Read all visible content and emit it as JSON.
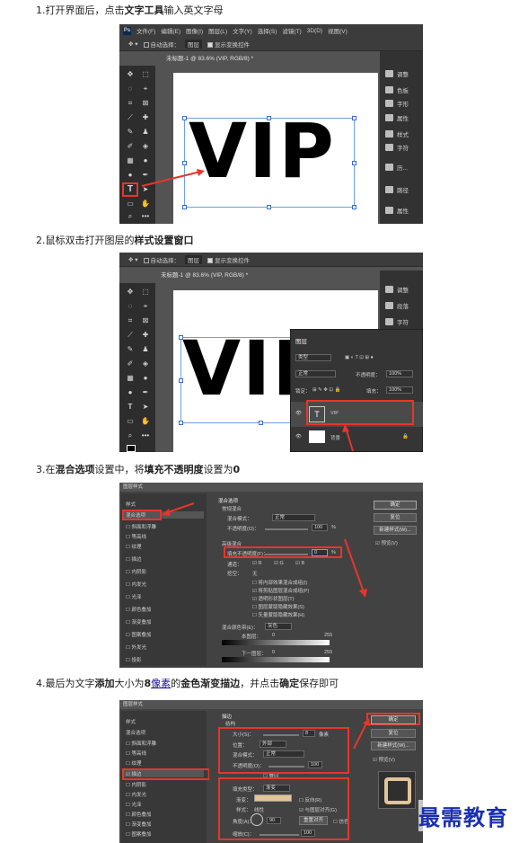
{
  "steps": {
    "s1": {
      "pre": "1.打开界面后，点击",
      "bold": "文字工具",
      "post": "输入英文字母"
    },
    "s2": {
      "pre": "2.鼠标双击打开图层的",
      "bold": "样式设置窗口",
      "post": ""
    },
    "s3": {
      "pre": "3.在",
      "bold1": "混合选项",
      "mid": "设置中，将",
      "bold2": "填充不透明度",
      "mid2": "设置为",
      "bold3": "0"
    },
    "s4": {
      "pre": "4.最后为文字",
      "b1": "添加",
      "t1": "大小为",
      "b2": "8",
      "link": "像素",
      "t2": "的",
      "b3": "金色渐变描边",
      "t3": "，并点击",
      "b4": "确定",
      "t4": "保存即可"
    }
  },
  "ps": {
    "logo": "Ps",
    "menu": [
      "文件(F)",
      "编辑(E)",
      "图像(I)",
      "图层(L)",
      "文字(Y)",
      "选择(S)",
      "滤镜(T)",
      "3D(D)",
      "视图(V)"
    ],
    "opts_auto_select": "自动选择：",
    "opts_layer": "图层",
    "opts_show_transform": "显示变换控件",
    "doc_tab": "未标题-1 @ 83.6% (VIP, RGB/8) *",
    "canvas_text": "VIP",
    "right_panel_1": [
      "调整",
      "色板",
      "字形",
      "属性",
      "样式",
      "字符",
      "历...",
      "路径",
      "属性"
    ],
    "right_panel_2": [
      "调整",
      "段落",
      "字符"
    ]
  },
  "layers_panel": {
    "title": "图层",
    "kind": "类型",
    "blend": "正常",
    "opacity_label": "不透明度：",
    "opacity": "100%",
    "lock_label": "锁定：",
    "fill_label": "填充：",
    "fill": "100%",
    "layer_vip": "VIP",
    "layer_bg": "背景"
  },
  "dialog3": {
    "title": "图层样式",
    "left_items": [
      "样式",
      "混合选项",
      "斜面和浮雕",
      "等高线",
      "纹理",
      "描边",
      "内阴影",
      "内发光",
      "光泽",
      "颜色叠加",
      "渐变叠加",
      "图案叠加",
      "外发光",
      "投影"
    ],
    "section": "混合选项",
    "general": "常规混合",
    "blend_mode_label": "混合模式：",
    "blend_mode": "正常",
    "opacity_label": "不透明度(O)：",
    "opacity": "100",
    "advanced": "高级混合",
    "fill_label": "填充不透明度(F)：",
    "fill_value": "0",
    "channels_label": "通道：",
    "channels": [
      "R",
      "G",
      "B"
    ],
    "knockout_label": "挖空：",
    "knockout": "无",
    "options": [
      "将内部效果混合成组(I)",
      "将剪贴图层混合成组(P)",
      "透明形状图层(T)",
      "图层蒙版隐藏效果(S)",
      "矢量蒙版隐藏效果(H)"
    ],
    "blend_if_label": "混合颜色带(E)：",
    "blend_if": "灰色",
    "this_layer": "本图层：",
    "under_layer": "下一图层：",
    "range_min": "0",
    "range_max": "255",
    "buttons": [
      "确定",
      "复位",
      "新建样式(W)...",
      "预览(V)"
    ],
    "unit": "%"
  },
  "dialog4": {
    "title": "图层样式",
    "section": "描边",
    "structure": "结构",
    "size_label": "大小(S)：",
    "size": "8",
    "size_unit": "像素",
    "position_label": "位置：",
    "position": "外部",
    "blend_label": "混合模式：",
    "blend": "正常",
    "opacity_label": "不透明度(O)：",
    "opacity": "100",
    "emboss_label": "叠印",
    "fill_type_label": "填充类型：",
    "fill_type": "渐变",
    "gradient_label": "渐变：",
    "reverse_label": "反向(R)",
    "style_label": "样式：",
    "style": "线性",
    "align_label": "与图层对齐(G)",
    "angle_label": "角度(A)：",
    "angle": "90",
    "reset_align": "重置对齐",
    "dither": "仿色",
    "scale_label": "缩放(C)：",
    "scale": "100",
    "buttons": [
      "确定",
      "复位",
      "新建样式(W)...",
      "预览(V)"
    ]
  },
  "watermark": "最需教育",
  "colors": {
    "red": "#e8352b",
    "gold": "#e2c49a",
    "ps_dark": "#2d2d2d"
  }
}
